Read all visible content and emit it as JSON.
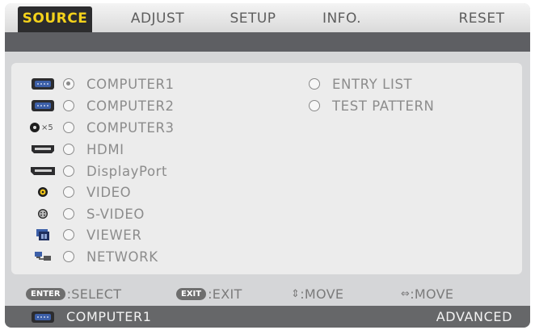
{
  "tabs": [
    {
      "label": "SOURCE",
      "active": true
    },
    {
      "label": "ADJUST",
      "active": false
    },
    {
      "label": "SETUP",
      "active": false
    },
    {
      "label": "INFO.",
      "active": false
    },
    {
      "label": "RESET",
      "active": false
    }
  ],
  "sources": [
    {
      "label": "COMPUTER1",
      "icon": "vga-connector-icon",
      "selected": true
    },
    {
      "label": "COMPUTER2",
      "icon": "vga-connector-icon",
      "selected": false
    },
    {
      "label": "COMPUTER3",
      "icon": "bnc-connector-icon",
      "icon_text": "×5",
      "selected": false
    },
    {
      "label": "HDMI",
      "icon": "hdmi-connector-icon",
      "selected": false
    },
    {
      "label": "DisplayPort",
      "icon": "displayport-connector-icon",
      "selected": false
    },
    {
      "label": "VIDEO",
      "icon": "rca-video-icon",
      "selected": false
    },
    {
      "label": "S-VIDEO",
      "icon": "s-video-connector-icon",
      "selected": false
    },
    {
      "label": "VIEWER",
      "icon": "usb-viewer-icon",
      "selected": false
    },
    {
      "label": "NETWORK",
      "icon": "network-icon",
      "selected": false
    }
  ],
  "extra_options": [
    {
      "label": "ENTRY LIST",
      "selected": false
    },
    {
      "label": "TEST PATTERN",
      "selected": false
    }
  ],
  "hints": {
    "select_key": "ENTER",
    "select_text": ":SELECT",
    "exit_key": "EXIT",
    "exit_text": ":EXIT",
    "move_v_glyph": "⇕",
    "move_v_text": ":MOVE",
    "move_h_glyph": "⇔",
    "move_h_text": ":MOVE"
  },
  "status": {
    "current_source": "COMPUTER1",
    "current_source_icon": "vga-connector-icon",
    "mode": "ADVANCED"
  },
  "colors": {
    "active_tab_bg": "#2c2c2e",
    "active_tab_text": "#f4d21b",
    "connector_blue": "#3c5fa8"
  }
}
